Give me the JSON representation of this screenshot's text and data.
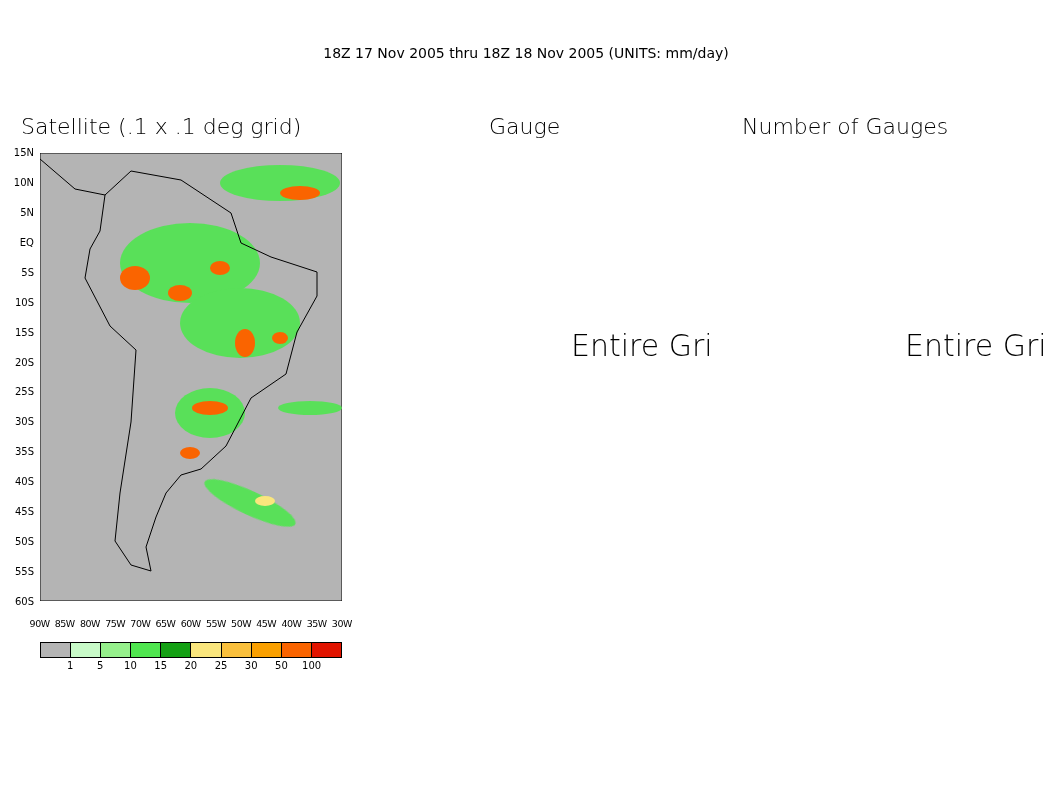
{
  "title": "18Z 17 Nov 2005 thru 18Z 18 Nov 2005 (UNITS: mm/day)",
  "panels": [
    {
      "kind": "map",
      "title": "Satellite (.1 x .1 deg grid)",
      "y_ticks": [
        "15N",
        "10N",
        "5N",
        "EQ",
        "5S",
        "10S",
        "15S",
        "20S",
        "25S",
        "30S",
        "35S",
        "40S",
        "45S",
        "50S",
        "55S",
        "60S"
      ],
      "x_ticks": [
        "90W",
        "85W",
        "80W",
        "75W",
        "70W",
        "65W",
        "60W",
        "55W",
        "50W",
        "45W",
        "40W",
        "35W",
        "30W"
      ],
      "legend": {
        "bins": [
          {
            "color": "#b4b4b4"
          },
          {
            "color": "#c8fac8"
          },
          {
            "color": "#96f08c"
          },
          {
            "color": "#50e650"
          },
          {
            "color": "#14a014"
          },
          {
            "color": "#fae67d"
          },
          {
            "color": "#fac03c"
          },
          {
            "color": "#faa000"
          },
          {
            "color": "#fa6400"
          },
          {
            "color": "#e11400"
          }
        ],
        "labels": [
          "1",
          "5",
          "10",
          "15",
          "20",
          "25",
          "30",
          "50",
          "100"
        ]
      }
    },
    {
      "kind": "message",
      "title": "Gauge",
      "message": "Entire Gri"
    },
    {
      "kind": "message",
      "title": "Number of Gauges",
      "message": "Entire Gri"
    }
  ]
}
